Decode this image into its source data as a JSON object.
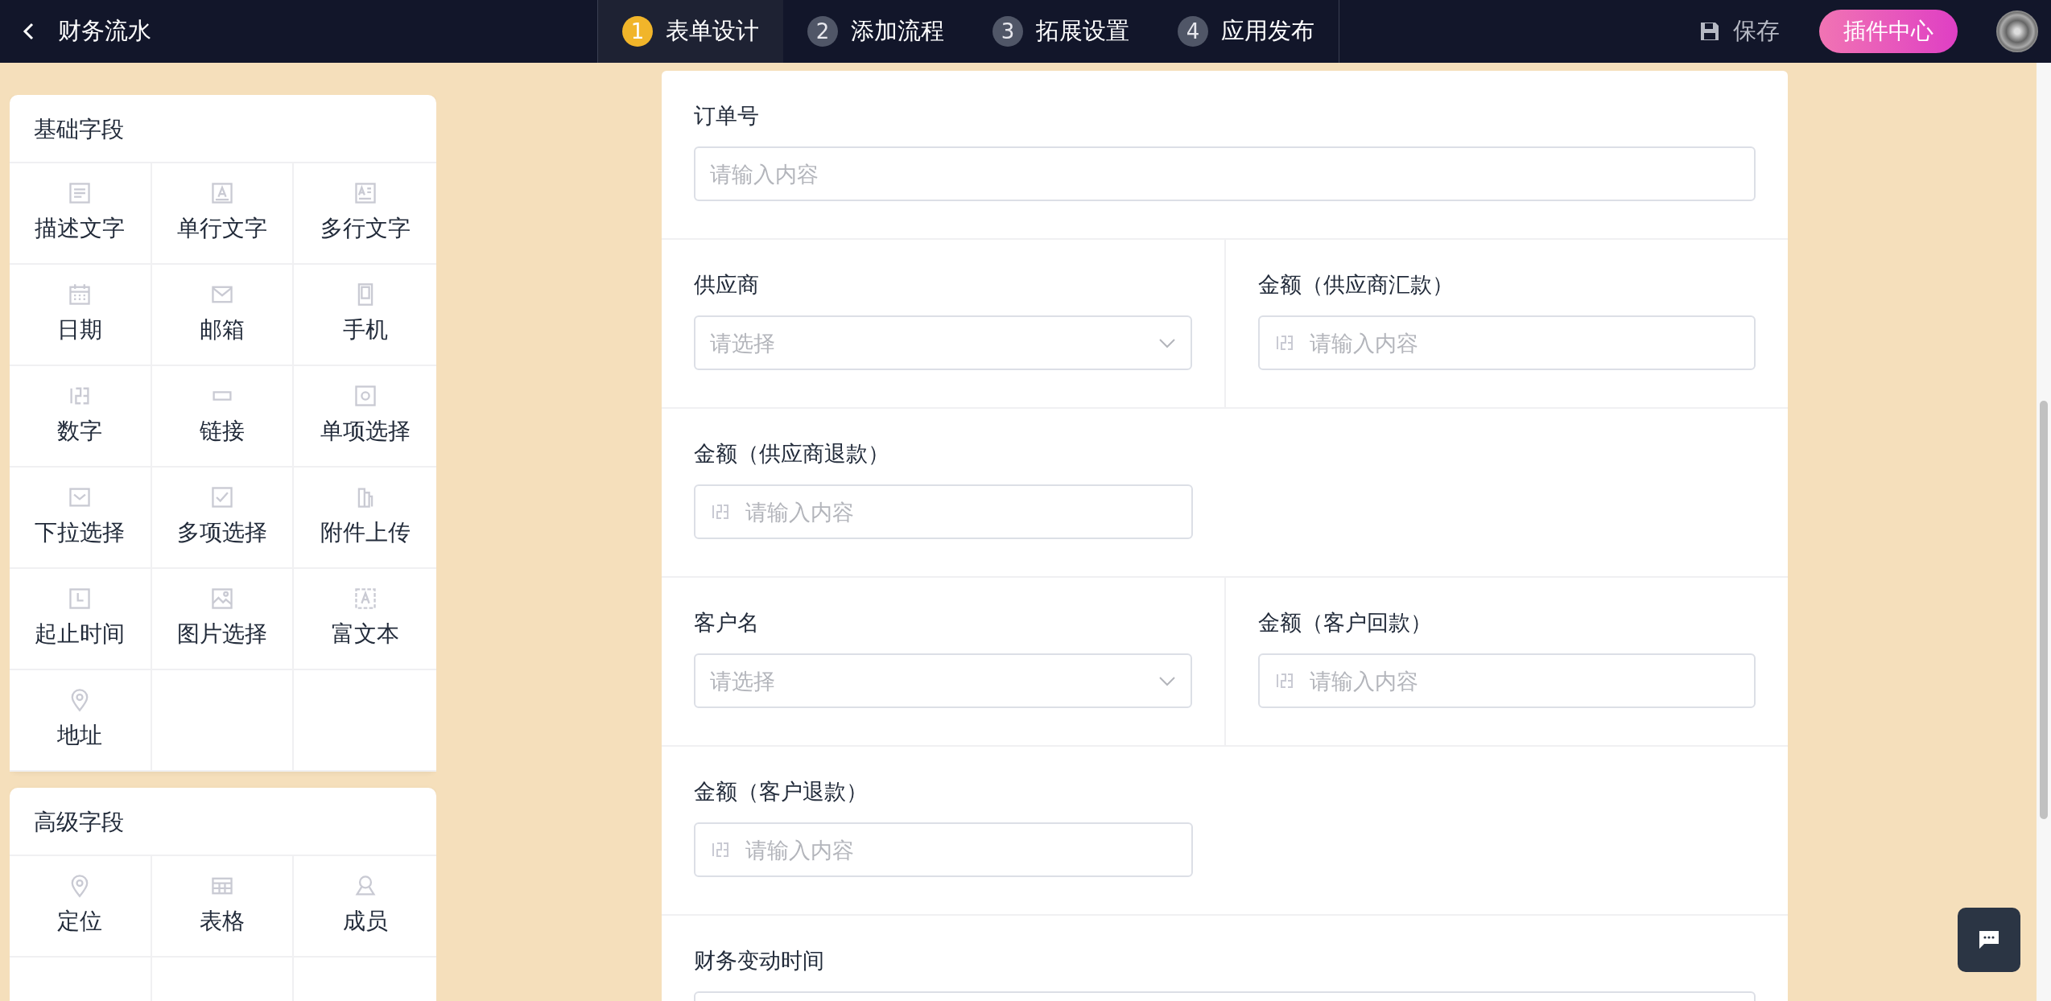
{
  "header": {
    "title": "财务流水",
    "save_label": "保存",
    "plugin_button": "插件中心",
    "steps": [
      {
        "number": "1",
        "label": "表单设计",
        "selected": true
      },
      {
        "number": "2",
        "label": "添加流程",
        "selected": false
      },
      {
        "number": "3",
        "label": "拓展设置",
        "selected": false
      },
      {
        "number": "4",
        "label": "应用发布",
        "selected": false
      }
    ]
  },
  "palette": [
    {
      "title": "基础字段",
      "items": [
        {
          "label": "描述文字"
        },
        {
          "label": "单行文字"
        },
        {
          "label": "多行文字"
        },
        {
          "label": "日期"
        },
        {
          "label": "邮箱"
        },
        {
          "label": "手机"
        },
        {
          "label": "数字"
        },
        {
          "label": "链接"
        },
        {
          "label": "单项选择"
        },
        {
          "label": "下拉选择"
        },
        {
          "label": "多项选择"
        },
        {
          "label": "附件上传"
        },
        {
          "label": "起止时间"
        },
        {
          "label": "图片选择"
        },
        {
          "label": "富文本"
        },
        {
          "label": "地址"
        }
      ]
    },
    {
      "title": "高级字段",
      "items": [
        {
          "label": "定位"
        },
        {
          "label": "表格"
        },
        {
          "label": "成员"
        }
      ]
    }
  ],
  "form": {
    "rows": [
      {
        "kind": "full",
        "fields": [
          {
            "label": "订单号",
            "kind": "text",
            "placeholder": "请输入内容"
          }
        ]
      },
      {
        "kind": "split",
        "fields": [
          {
            "label": "供应商",
            "kind": "select",
            "placeholder": "请选择"
          },
          {
            "label": "金额（供应商汇款）",
            "kind": "number",
            "placeholder": "请输入内容"
          }
        ]
      },
      {
        "kind": "split",
        "fields": [
          {
            "label": "金额（供应商退款）",
            "kind": "number",
            "placeholder": "请输入内容"
          }
        ]
      },
      {
        "kind": "split",
        "fields": [
          {
            "label": "客户名",
            "kind": "select",
            "placeholder": "请选择"
          },
          {
            "label": "金额（客户回款）",
            "kind": "number",
            "placeholder": "请输入内容"
          }
        ]
      },
      {
        "kind": "split",
        "fields": [
          {
            "label": "金额（客户退款）",
            "kind": "number",
            "placeholder": "请输入内容"
          }
        ]
      },
      {
        "kind": "full",
        "fields": [
          {
            "label": "财务变动时间",
            "kind": "text"
          }
        ]
      }
    ]
  }
}
